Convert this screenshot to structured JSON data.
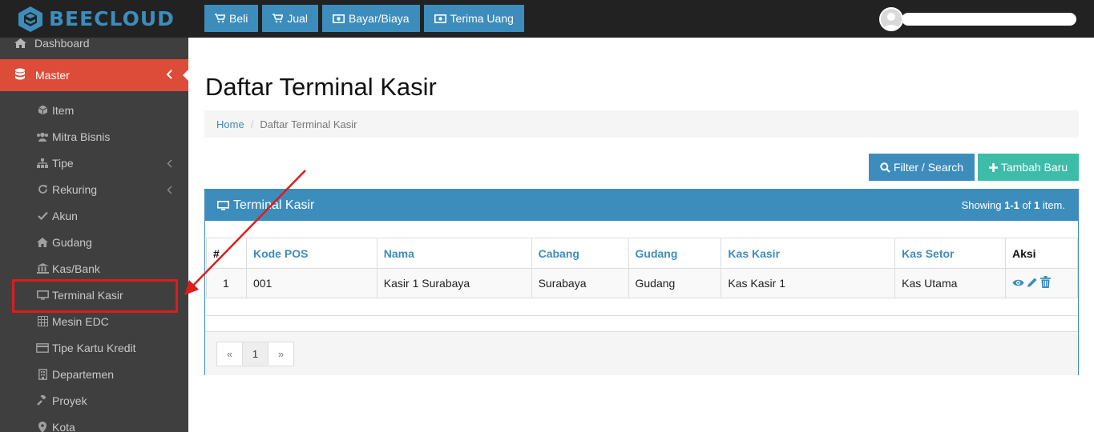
{
  "brand": {
    "name": "BEECLOUD",
    "color": "#3c8dbc"
  },
  "topnav": [
    {
      "label": "Beli",
      "icon": "cart-icon"
    },
    {
      "label": "Jual",
      "icon": "cart-icon"
    },
    {
      "label": "Bayar/Biaya",
      "icon": "money-icon"
    },
    {
      "label": "Terima Uang",
      "icon": "money-icon"
    }
  ],
  "sidebar": {
    "dashboard": "Dashboard",
    "master": "Master",
    "items": [
      {
        "label": "Item",
        "icon": "cube-icon"
      },
      {
        "label": "Mitra Bisnis",
        "icon": "users-icon"
      },
      {
        "label": "Tipe",
        "icon": "sitemap-icon",
        "has_children": true
      },
      {
        "label": "Rekuring",
        "icon": "refresh-icon",
        "has_children": true
      },
      {
        "label": "Akun",
        "icon": "check-icon"
      },
      {
        "label": "Gudang",
        "icon": "home-icon"
      },
      {
        "label": "Kas/Bank",
        "icon": "bank-icon"
      },
      {
        "label": "Terminal Kasir",
        "icon": "desktop-icon",
        "highlighted": true
      },
      {
        "label": "Mesin EDC",
        "icon": "calculator-icon"
      },
      {
        "label": "Tipe Kartu Kredit",
        "icon": "credit-card-icon"
      },
      {
        "label": "Departemen",
        "icon": "building-icon"
      },
      {
        "label": "Proyek",
        "icon": "gavel-icon"
      },
      {
        "label": "Kota",
        "icon": "map-marker-icon"
      }
    ]
  },
  "page": {
    "title": "Daftar Terminal Kasir",
    "breadcrumb": {
      "home": "Home",
      "separator": "/",
      "current": "Daftar Terminal Kasir"
    },
    "filter_button": "Filter / Search",
    "add_button": "Tambah Baru"
  },
  "panel": {
    "title": "Terminal Kasir",
    "summary_prefix": "Showing ",
    "summary_range": "1-1",
    "summary_of": " of ",
    "summary_total": "1",
    "summary_suffix": " item.",
    "columns": [
      "#",
      "Kode POS",
      "Nama",
      "Cabang",
      "Gudang",
      "Kas Kasir",
      "Kas Setor",
      "Aksi"
    ],
    "rows": [
      {
        "no": "1",
        "kode_pos": "001",
        "nama": "Kasir 1 Surabaya",
        "cabang": "Surabaya",
        "gudang": "Gudang",
        "kas_kasir": "Kas Kasir 1",
        "kas_setor": "Kas Utama"
      }
    ],
    "pagination": {
      "prev": "«",
      "current": "1",
      "next": "»"
    }
  },
  "colors": {
    "primary": "#3c8dbc",
    "danger": "#dd4b39",
    "success": "#3dbca8",
    "sidebar": "#3f3f3f",
    "topbar": "#222222",
    "annotation": "#e01b1b"
  }
}
